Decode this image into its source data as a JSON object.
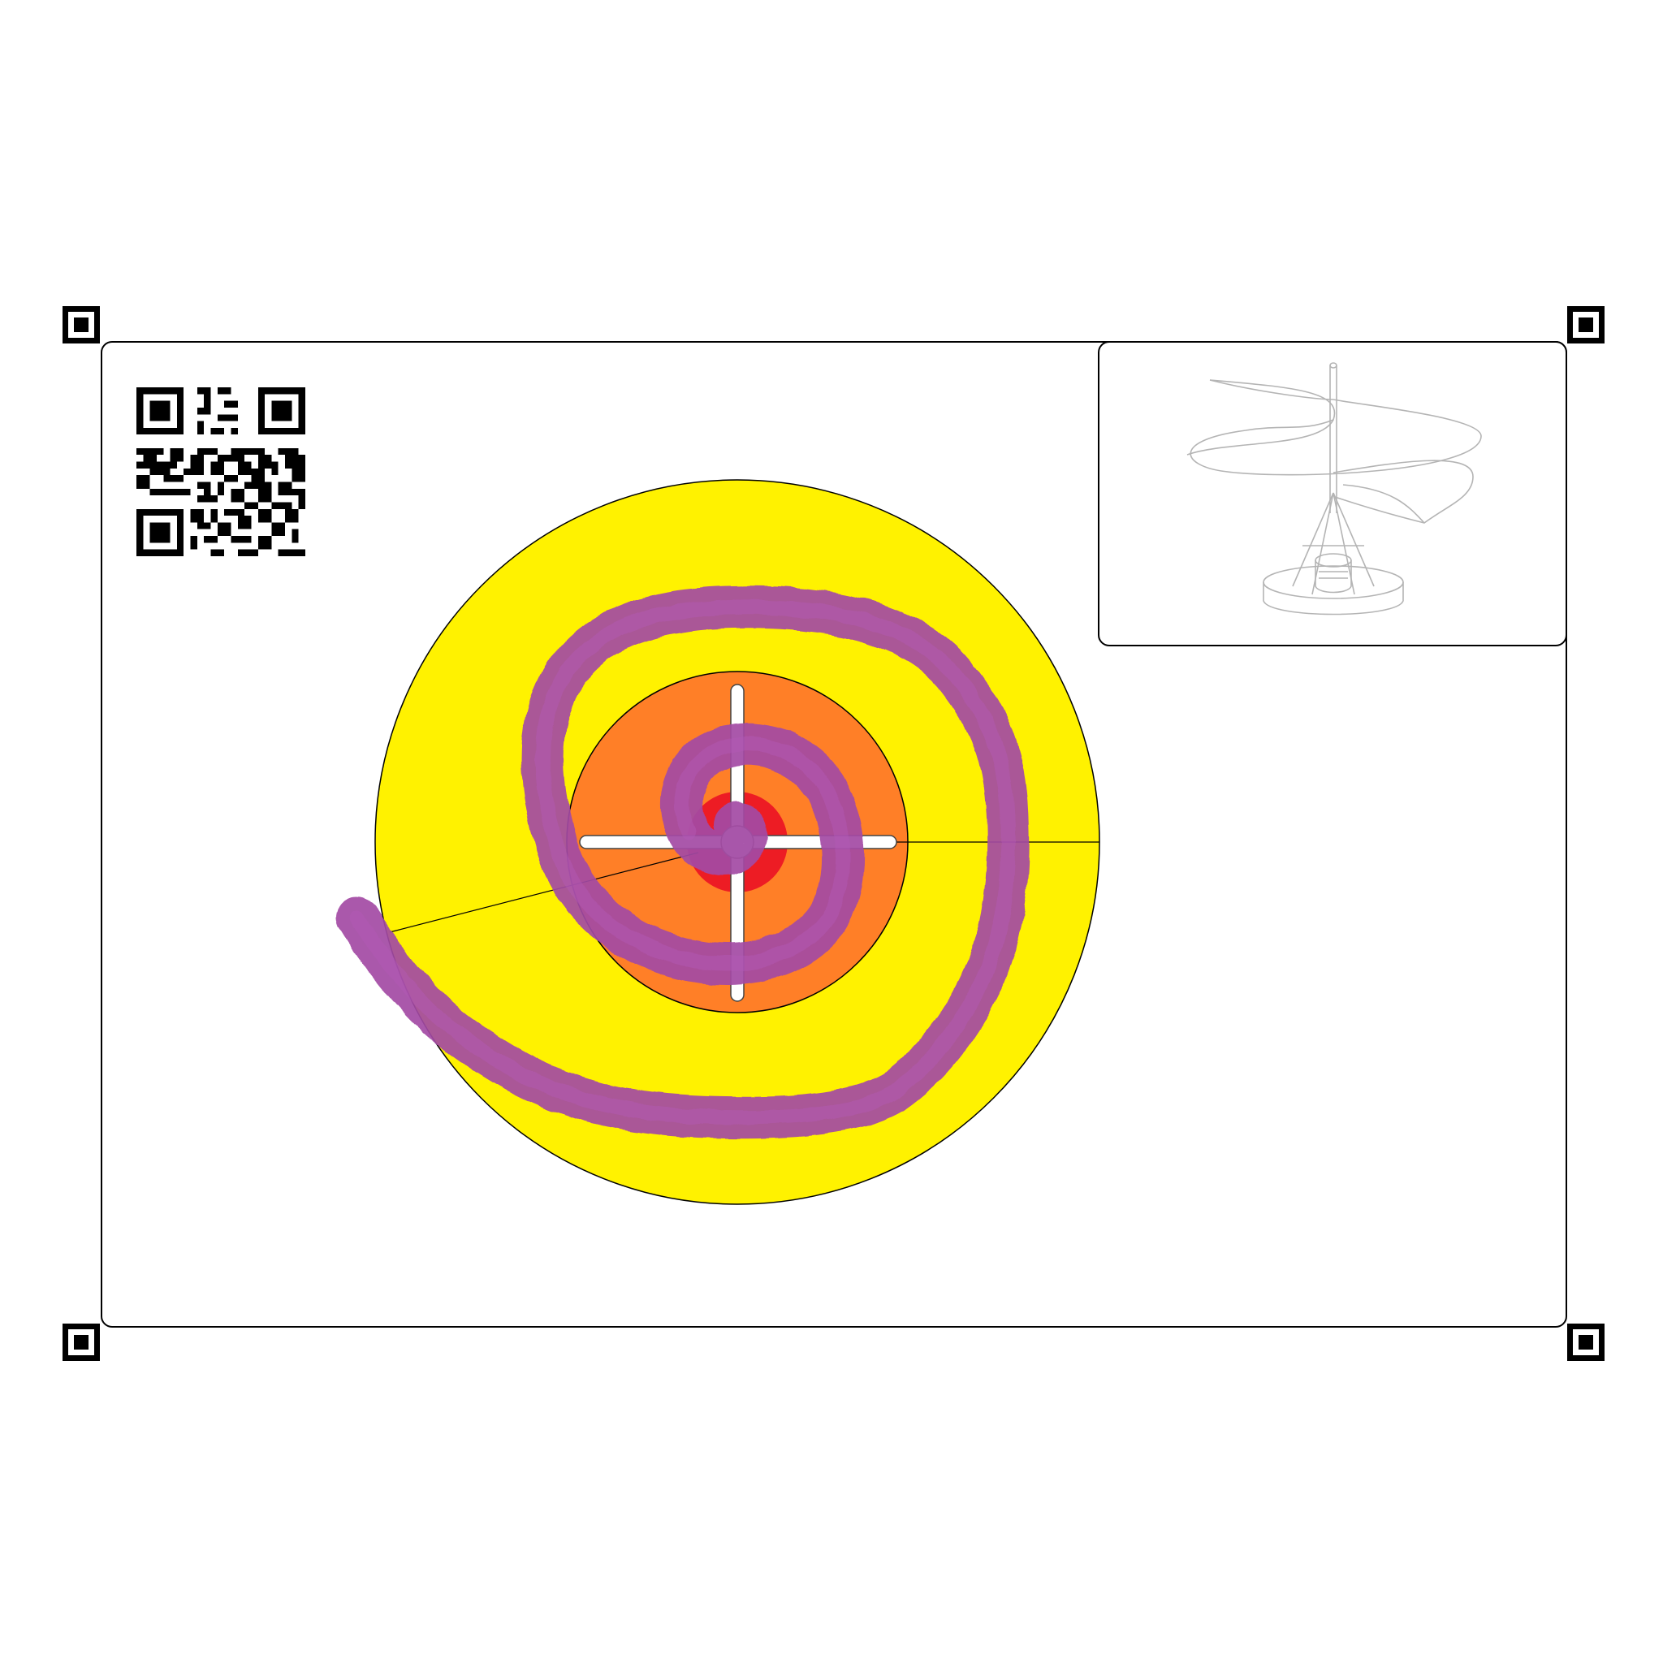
{
  "colors": {
    "outer_ring": "#FFF200",
    "middle_ring": "#FF7F27",
    "bullseye": "#ED1C24",
    "stroke": "#A349A4",
    "frame": "#000000",
    "crosshair": "#FFFFFF"
  },
  "markers": [
    "corner-marker-top-left",
    "corner-marker-top-right",
    "corner-marker-bottom-left",
    "corner-marker-bottom-right"
  ],
  "icons": {
    "qr_code": "qr-code-icon",
    "thumbnail": "helicopter-sketch-icon"
  },
  "target": {
    "rings": [
      "outer",
      "middle",
      "bullseye"
    ]
  }
}
